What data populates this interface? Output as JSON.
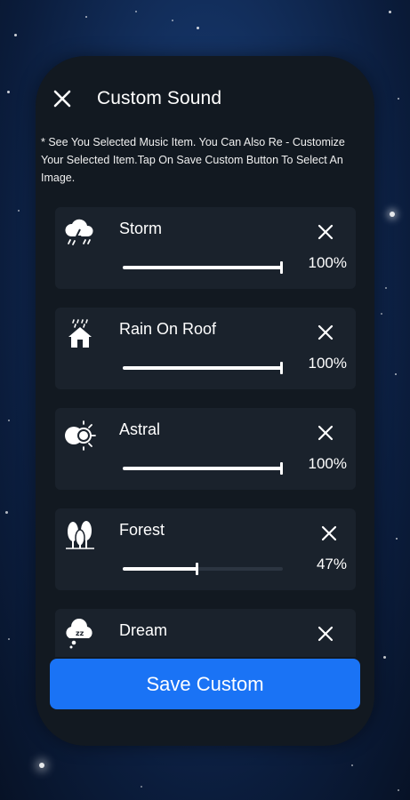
{
  "header": {
    "title": "Custom Sound"
  },
  "info_text": "* See You Selected Music Item. You Can Also Re - Customize Your Selected Item.Tap On Save Custom Button To Select An Image.",
  "items": [
    {
      "name": "Storm",
      "percent_label": "100%",
      "volume": 1.0,
      "icon": "storm-cloud-icon"
    },
    {
      "name": "Rain On Roof",
      "percent_label": "100%",
      "volume": 1.0,
      "icon": "rain-house-icon"
    },
    {
      "name": "Astral",
      "percent_label": "100%",
      "volume": 1.0,
      "icon": "astral-icon"
    },
    {
      "name": "Forest",
      "percent_label": "47%",
      "volume": 0.47,
      "icon": "forest-trees-icon"
    },
    {
      "name": "Dream",
      "percent_label": "",
      "volume": null,
      "icon": "dream-cloud-icon"
    }
  ],
  "save_button": {
    "label": "Save Custom",
    "color": "#1a73f5"
  },
  "colors": {
    "card_bg": "#121921",
    "item_bg": "#1a222c",
    "accent": "#1a73f5"
  }
}
